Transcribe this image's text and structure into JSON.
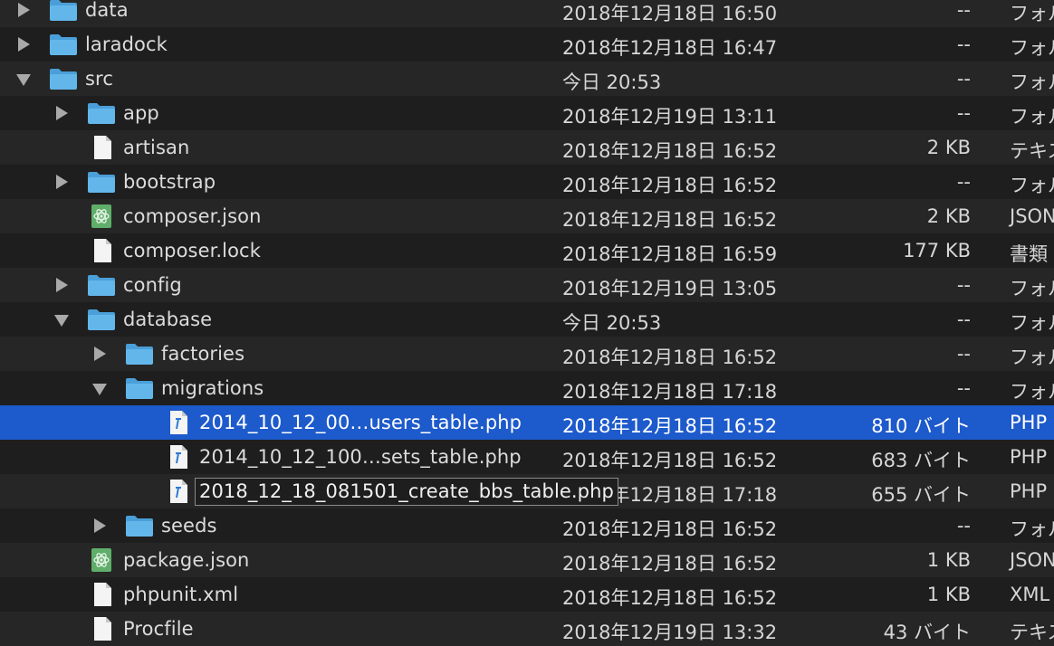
{
  "rows": [
    {
      "name": "data",
      "date": "2018年12月18日 16:50",
      "size": "--",
      "kind": "フォルダ",
      "type": "folder",
      "depth": 0,
      "state": "collapsed"
    },
    {
      "name": "laradock",
      "date": "2018年12月18日 16:47",
      "size": "--",
      "kind": "フォルダ",
      "type": "folder",
      "depth": 0,
      "state": "collapsed"
    },
    {
      "name": "src",
      "date": "今日 20:53",
      "size": "--",
      "kind": "フォルダ",
      "type": "folder",
      "depth": 0,
      "state": "expanded"
    },
    {
      "name": "app",
      "date": "2018年12月19日 13:11",
      "size": "--",
      "kind": "フォルダ",
      "type": "folder",
      "depth": 1,
      "state": "collapsed"
    },
    {
      "name": "artisan",
      "date": "2018年12月18日 16:52",
      "size": "2 KB",
      "kind": "テキスト",
      "type": "doc",
      "depth": 1,
      "state": "none"
    },
    {
      "name": "bootstrap",
      "date": "2018年12月18日 16:52",
      "size": "--",
      "kind": "フォルダ",
      "type": "folder",
      "depth": 1,
      "state": "collapsed"
    },
    {
      "name": "composer.json",
      "date": "2018年12月18日 16:52",
      "size": "2 KB",
      "kind": "JSON",
      "type": "atom",
      "depth": 1,
      "state": "none"
    },
    {
      "name": "composer.lock",
      "date": "2018年12月18日 16:59",
      "size": "177 KB",
      "kind": "書類",
      "type": "doc",
      "depth": 1,
      "state": "none"
    },
    {
      "name": "config",
      "date": "2018年12月19日 13:05",
      "size": "--",
      "kind": "フォルダ",
      "type": "folder",
      "depth": 1,
      "state": "collapsed"
    },
    {
      "name": "database",
      "date": "今日 20:53",
      "size": "--",
      "kind": "フォルダ",
      "type": "folder",
      "depth": 1,
      "state": "expanded"
    },
    {
      "name": "factories",
      "date": "2018年12月18日 16:52",
      "size": "--",
      "kind": "フォルダ",
      "type": "folder",
      "depth": 2,
      "state": "collapsed"
    },
    {
      "name": "migrations",
      "date": "2018年12月18日 17:18",
      "size": "--",
      "kind": "フォルダ",
      "type": "folder",
      "depth": 2,
      "state": "expanded"
    },
    {
      "name": "2014_10_12_00…users_table.php",
      "date": "2018年12月18日 16:52",
      "size": "810 バイト",
      "kind": "PHP",
      "type": "php",
      "depth": 3,
      "state": "none",
      "selected": true
    },
    {
      "name": "2014_10_12_100…sets_table.php",
      "date": "2018年12月18日 16:52",
      "size": "683 バイト",
      "kind": "PHP",
      "type": "php",
      "depth": 3,
      "state": "none"
    },
    {
      "name": "2018_12_18_081501_create_bbs_table.php",
      "date": "2018年12月18日 17:18",
      "size": "655 バイト",
      "kind": "PHP",
      "type": "php",
      "depth": 3,
      "state": "none",
      "editing": true
    },
    {
      "name": "seeds",
      "date": "2018年12月18日 16:52",
      "size": "--",
      "kind": "フォルダ",
      "type": "folder",
      "depth": 2,
      "state": "collapsed"
    },
    {
      "name": "package.json",
      "date": "2018年12月18日 16:52",
      "size": "1 KB",
      "kind": "JSON",
      "type": "atom",
      "depth": 1,
      "state": "none"
    },
    {
      "name": "phpunit.xml",
      "date": "2018年12月18日 16:52",
      "size": "1 KB",
      "kind": "XML",
      "type": "doc",
      "depth": 1,
      "state": "none"
    },
    {
      "name": "Procfile",
      "date": "2018年12月19日 13:32",
      "size": "43 バイト",
      "kind": "テキスト",
      "type": "doc",
      "depth": 1,
      "state": "none"
    }
  ],
  "colors": {
    "selection": "#1d5acb",
    "folder": "#5fb3e8",
    "background": "#1e1e1e"
  }
}
